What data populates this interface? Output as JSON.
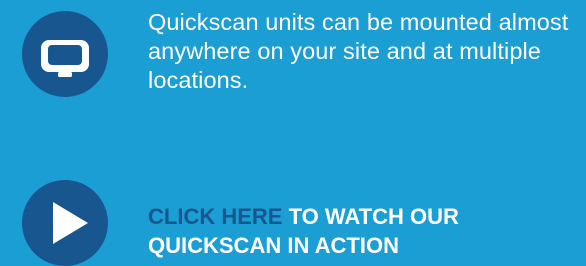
{
  "colors": {
    "background": "#1a9ed4",
    "icon_circle": "#18568f",
    "text": "#ffffff",
    "link": "#18568f"
  },
  "feature": {
    "icon": "monitor-icon",
    "text": "Quickscan units can be mounted almost anywhere on your site and at multiple locations."
  },
  "cta": {
    "icon": "play-icon",
    "link_text": "CLICK HERE",
    "rest_line1": " TO WATCH OUR",
    "rest_line2": "QUICKSCAN IN ACTION"
  }
}
